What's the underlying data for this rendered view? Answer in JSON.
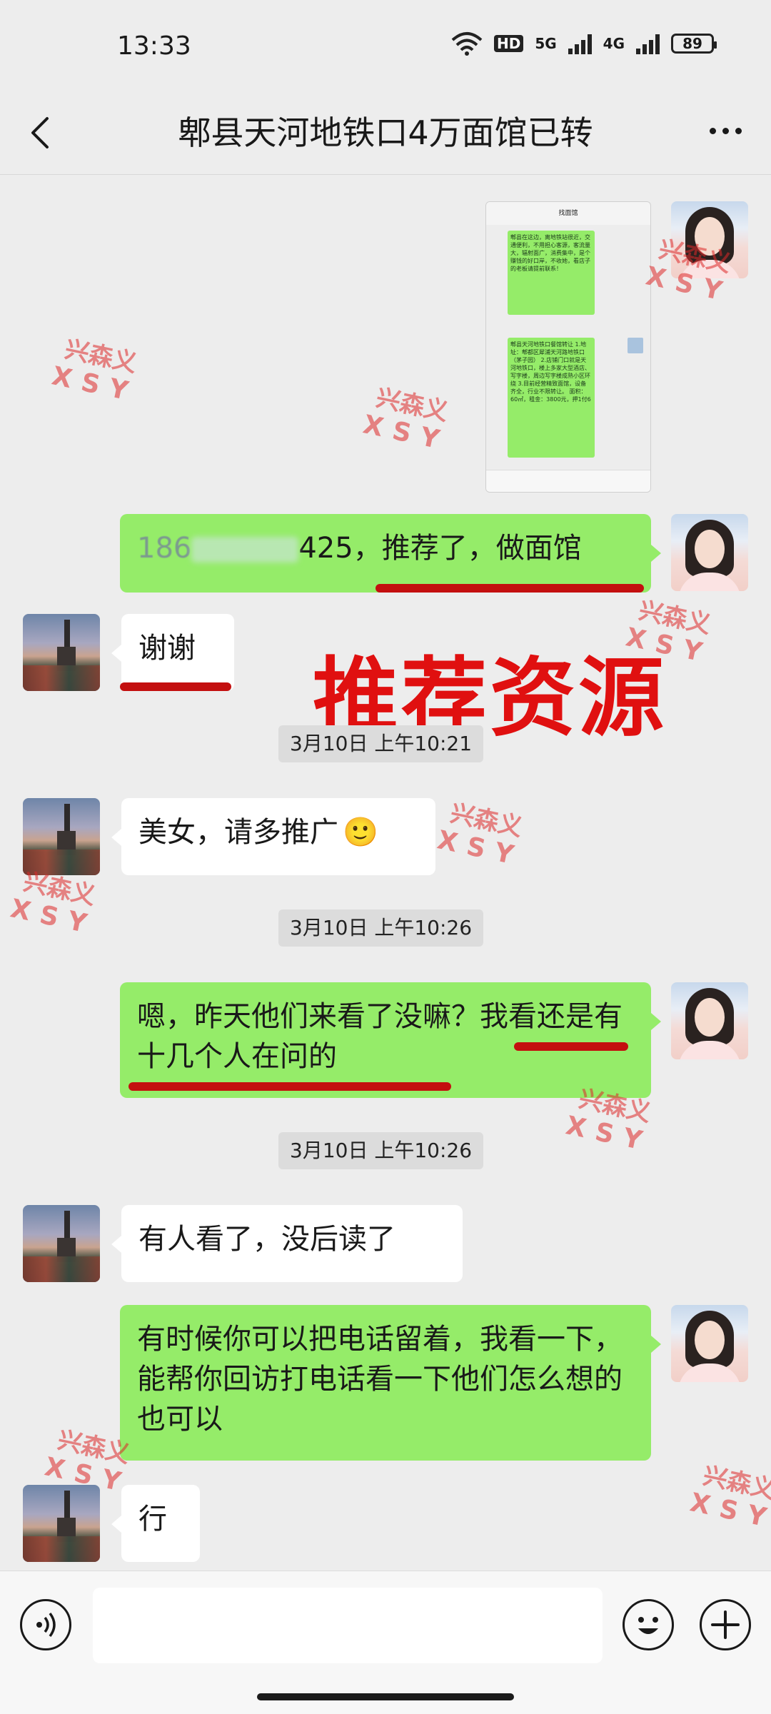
{
  "status_bar": {
    "time": "13:33",
    "network_hd": "HD",
    "network_5g": "5G",
    "network_4g": "4G",
    "battery": "89"
  },
  "header": {
    "title": "郫县天河地铁口4万面馆已转"
  },
  "overlay": {
    "title": "推荐资源"
  },
  "watermark": {
    "line1": "兴森义",
    "line2": "XSY"
  },
  "thumbnail": {
    "title": "找面馆",
    "bubble1": "郫县在这边，离地铁站很近，交通便利，不用担心客源，客流量大，辐射面广，消费集中，是个赚钱的好口岸，不收她，看店子的老板请提前联系！",
    "bubble2": "郫县天河地铁口餐馆转让 1.地址：郫都区犀浦天河路地铁口（茅子园） 2.店铺门口就是天河地铁口，楼上多家大型酒店、写字楼，周边写字楼成熟小区环绕 3.目前经营精致面馆，设备齐全，行业不限转让。 面积：60㎡，租金：3800元，押1付6"
  },
  "messages": [
    {
      "side": "right",
      "text_masked": "186",
      "text_tail": "425，推荐了，做面馆"
    },
    {
      "side": "left",
      "text": "谢谢"
    },
    {
      "type": "timestamp",
      "text": "3月10日 上午10:21"
    },
    {
      "side": "left",
      "text": "美女，请多推广",
      "emoji": "🙂"
    },
    {
      "type": "timestamp",
      "text": "3月10日 上午10:26"
    },
    {
      "side": "right",
      "text": "嗯，昨天他们来看了没嘛？我看还是有十几个人在问的"
    },
    {
      "type": "timestamp",
      "text": "3月10日 上午10:26"
    },
    {
      "side": "left",
      "text": "有人看了，没后读了"
    },
    {
      "side": "right",
      "text": "有时候你可以把电话留着，我看一下，能帮你回访打电话看一下他们怎么想的也可以"
    },
    {
      "side": "left",
      "text": "行"
    }
  ],
  "colors": {
    "bubble_green": "#95ec69",
    "background": "#ededed",
    "highlight_red": "#c30f0f"
  },
  "icons": {
    "back": "chevron-left-icon",
    "more": "more-dots-icon",
    "voice": "voice-icon",
    "emoji": "emoji-icon",
    "plus": "plus-icon"
  }
}
